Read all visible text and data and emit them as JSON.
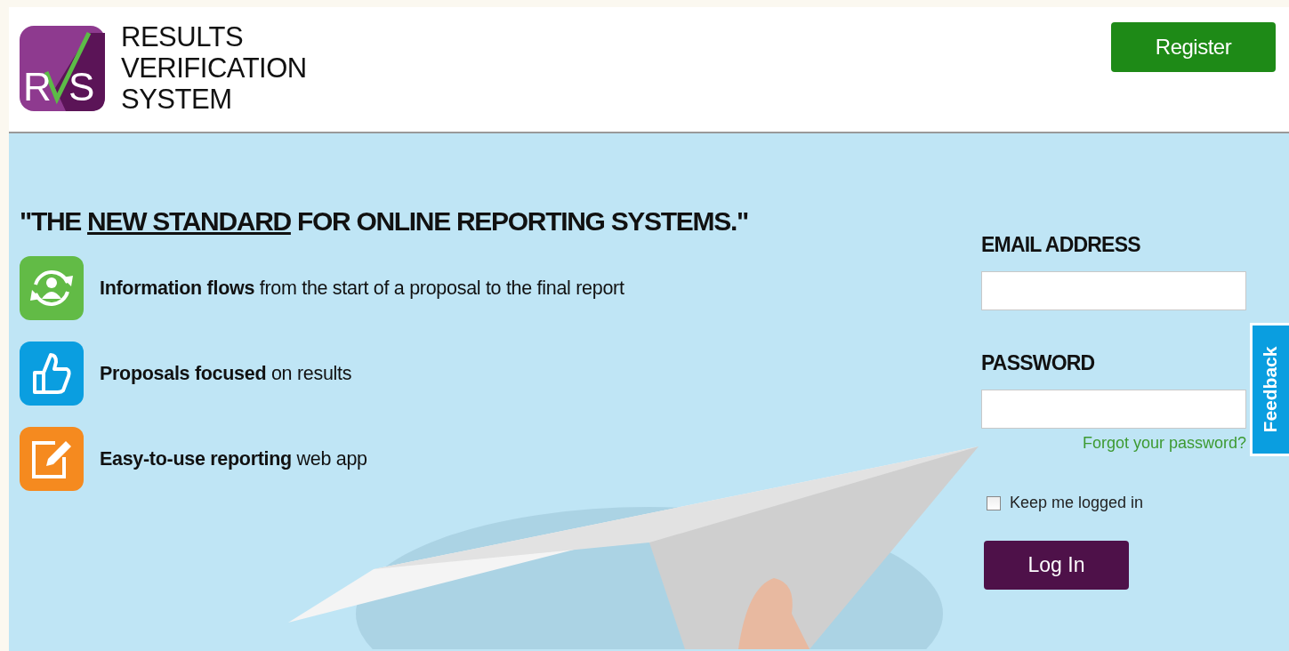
{
  "header": {
    "logo_letters": [
      "R",
      "S"
    ],
    "logo_lines": [
      "RESULTS",
      "VERIFICATION",
      "SYSTEM"
    ],
    "register_button": "Register"
  },
  "headline": {
    "before": "\"THE ",
    "link": "NEW STANDARD",
    "after": " FOR ONLINE REPORTING SYSTEMS.\""
  },
  "features": [
    {
      "kind": "cycle",
      "color": "#62bb46",
      "text": "**Information flows** from the start of a proposal to the final report"
    },
    {
      "kind": "thumb",
      "color": "#0a9ee0",
      "text": "**Proposals focused** on results"
    },
    {
      "kind": "edit",
      "color": "#f58a1f",
      "text": "**Easy-to-use reporting** web app"
    }
  ],
  "login": {
    "email_label": "EMAIL ADDRESS",
    "password_label": "PASSWORD",
    "forgot_link": "Forgot your password?",
    "keep_logged_in": {
      "label": "Keep me logged in",
      "checked": false
    },
    "login_button": "Log In"
  },
  "feedback_tab": "Feedback"
}
